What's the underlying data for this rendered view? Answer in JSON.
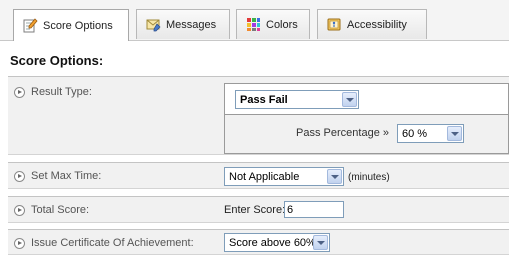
{
  "tabs": [
    {
      "label": "Score Options",
      "icon": "pencil-paper-icon",
      "active": true
    },
    {
      "label": "Messages",
      "icon": "envelope-edit-icon",
      "active": false
    },
    {
      "label": "Colors",
      "icon": "color-palette-icon",
      "active": false
    },
    {
      "label": "Accessibility",
      "icon": "accessibility-book-icon",
      "active": false
    }
  ],
  "section": {
    "title": "Score Options:"
  },
  "result_type": {
    "label": "Result Type:",
    "value": "Pass Fail",
    "pass_percentage_label": "Pass Percentage »",
    "pass_percentage_value": "60 %"
  },
  "max_time": {
    "label": "Set Max Time:",
    "value": "Not Applicable",
    "unit": "(minutes)"
  },
  "total_score": {
    "label": "Total Score:",
    "enter_label": "Enter Score:",
    "value": "6"
  },
  "certificate": {
    "label": "Issue Certificate Of Achievement:",
    "value": "Score above 60%"
  },
  "colors": {
    "row_bg": "#f1f1f1",
    "tab_bg": "#f4f4f4",
    "select_border": "#7f9db9"
  }
}
